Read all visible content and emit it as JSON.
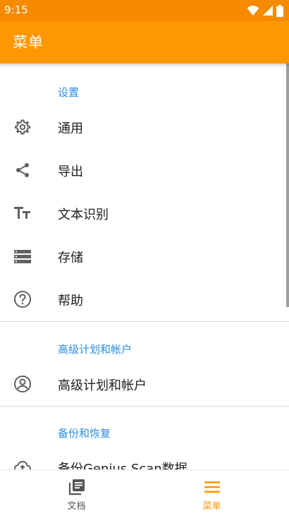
{
  "status_bar": {
    "time": "9:15"
  },
  "app_bar": {
    "title": "菜单"
  },
  "sections": {
    "settings": {
      "header": "设置"
    },
    "premium": {
      "header": "高级计划和帐户"
    },
    "backup": {
      "header": "备份和恢复"
    }
  },
  "menu": {
    "general": {
      "label": "通用",
      "icon": "gear-icon"
    },
    "export": {
      "label": "导出",
      "icon": "share-icon"
    },
    "ocr": {
      "label": "文本识别",
      "icon": "text-format-icon"
    },
    "storage": {
      "label": "存储",
      "icon": "storage-icon"
    },
    "help": {
      "label": "帮助",
      "icon": "help-icon"
    },
    "premium_account": {
      "label": "高级计划和帐户",
      "icon": "account-icon"
    },
    "backup": {
      "label": "备份Genius Scan数据",
      "icon": "backup-icon"
    }
  },
  "bottom_nav": {
    "items": [
      {
        "label": "文档",
        "icon": "documents-icon",
        "active": false
      },
      {
        "label": "菜单",
        "icon": "menu-icon",
        "active": true
      }
    ]
  },
  "colors": {
    "accent": "#ff9700",
    "status_bar": "#f68a00",
    "section_header": "#2a8cde"
  }
}
